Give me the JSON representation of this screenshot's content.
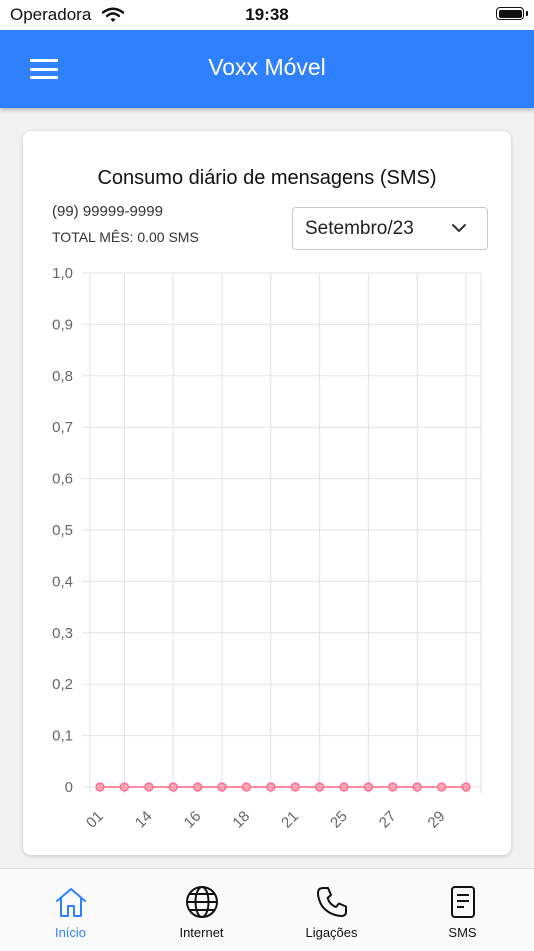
{
  "status_bar": {
    "carrier": "Operadora",
    "time": "19:38"
  },
  "app_bar": {
    "title": "Voxx Móvel"
  },
  "card": {
    "title": "Consumo diário de mensagens (SMS)",
    "phone": "(99) 99999-9999",
    "total": "TOTAL MÊS: 0.00 SMS",
    "month_select": {
      "value": "Setembro/23"
    }
  },
  "chart_data": {
    "type": "line",
    "title": "Consumo diário de mensagens (SMS)",
    "xlabel": "",
    "ylabel": "",
    "ylim": [
      0,
      1.0
    ],
    "yticks": [
      "0",
      "0,1",
      "0,2",
      "0,3",
      "0,4",
      "0,5",
      "0,6",
      "0,7",
      "0,8",
      "0,9",
      "1,0"
    ],
    "xtick_labels": [
      "01",
      "14",
      "16",
      "18",
      "21",
      "25",
      "27",
      "29"
    ],
    "grid": true,
    "color": "#ff6384",
    "series": [
      {
        "values": [
          0,
          0,
          0,
          0,
          0,
          0,
          0,
          0,
          0,
          0,
          0,
          0,
          0,
          0,
          0,
          0
        ]
      }
    ]
  },
  "bottom_nav": {
    "active_color": "#2f80ff",
    "items": [
      {
        "label": "Início",
        "icon": "home-icon",
        "active": true
      },
      {
        "label": "Internet",
        "icon": "globe-icon",
        "active": false
      },
      {
        "label": "Ligações",
        "icon": "phone-icon",
        "active": false
      },
      {
        "label": "SMS",
        "icon": "sms-document-icon",
        "active": false
      }
    ]
  }
}
